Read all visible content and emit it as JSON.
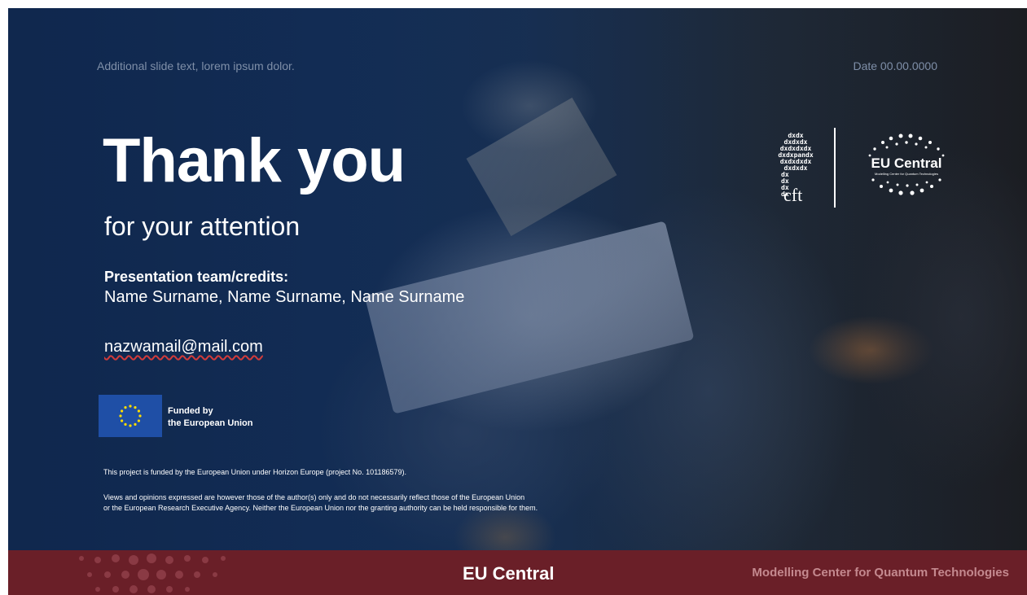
{
  "slide": {
    "top_left_text": "Additional slide text, lorem ipsum dolor.",
    "top_right_date": "Date 00.00.0000",
    "title": "Thank you",
    "subtitle": "for your attention",
    "credits_title": "Presentation team/credits:",
    "credits_names": "Name Surname, Name Surname, Name Surname",
    "email": "nazwamail@mail.com",
    "funded_line1": "Funded by",
    "funded_line2": "the European Union",
    "disclaimer_funding": "This project is funded by the European Union under Horizon Europe (project No. 101186579).",
    "disclaimer_views_line1": "Views and opinions expressed are however those of the author(s) only and do not necessarily reflect those of the European Union",
    "disclaimer_views_line2": "or the European Research Executive Agency. Neither the European Union nor the granting authority can be held responsible  for them."
  },
  "logos": {
    "cft_lines": [
      "dxdx",
      "dxdxdx",
      "dxdxdxdx",
      "dxdxpandx",
      "dxdxdxdx",
      "dxdxdx",
      "dx",
      "dx",
      "dx",
      "dx"
    ],
    "cft_word": "cft",
    "eu_central_title": "EU Central",
    "eu_central_subtitle": "Modelling Center for Quantum Technologies"
  },
  "footer": {
    "center_text": "EU Central",
    "right_text": "Modelling Center for Quantum Technologies"
  },
  "colors": {
    "footer_bg": "#6a1f28",
    "footer_right_text": "#c4898f",
    "eu_flag_blue": "#1f4fa6",
    "eu_flag_stars": "#ffdd00"
  },
  "icons": {
    "eu_flag": "eu-flag-icon",
    "footer_pattern": "dot-pattern-icon"
  }
}
